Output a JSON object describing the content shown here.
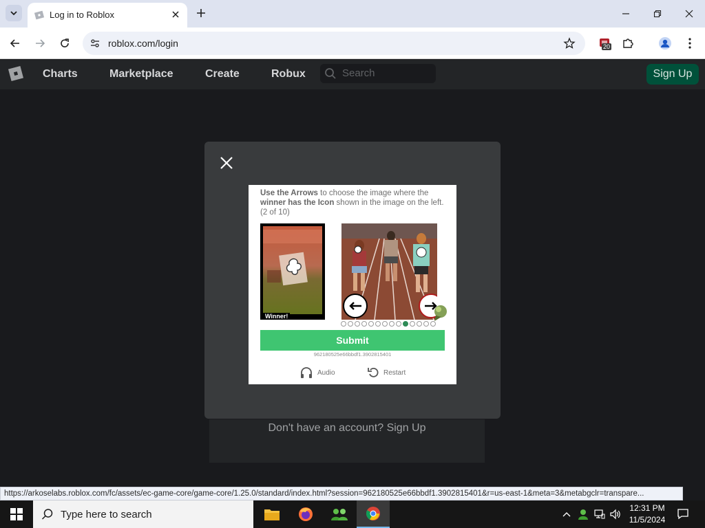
{
  "browser": {
    "tab_title": "Log in to Roblox",
    "url": "roblox.com/login",
    "extension_badge": "20",
    "status_url": "https://arkoselabs.roblox.com/fc/assets/ec-game-core/game-core/1.25.0/standard/index.html?session=962180525e66bbdf1.3902815401&r=us-east-1&meta=3&metabgclr=transpare..."
  },
  "roblox_header": {
    "nav": [
      "Charts",
      "Marketplace",
      "Create",
      "Robux"
    ],
    "search_placeholder": "Search",
    "signup_label": "Sign Up"
  },
  "page": {
    "signup_prompt": "Don't have an account? Sign Up"
  },
  "captcha": {
    "instruction_bold_1": "Use the Arrows",
    "instruction_text_1": " to choose the image where the ",
    "instruction_bold_2": "winner has the Icon",
    "instruction_text_2": " shown in the image on the left. (2 of 10)",
    "winner_label": "Winner!",
    "submit_label": "Submit",
    "session_id": "962180525e66bbdf1.3902815401",
    "audio_label": "Audio",
    "restart_label": "Restart",
    "dot_count": 14,
    "active_dot": 9
  },
  "taskbar": {
    "search_placeholder": "Type here to search",
    "time": "12:31 PM",
    "date": "11/5/2024"
  },
  "colors": {
    "submit": "#3fc571",
    "signup_btn": "#00513a",
    "background": "#191a1d"
  }
}
